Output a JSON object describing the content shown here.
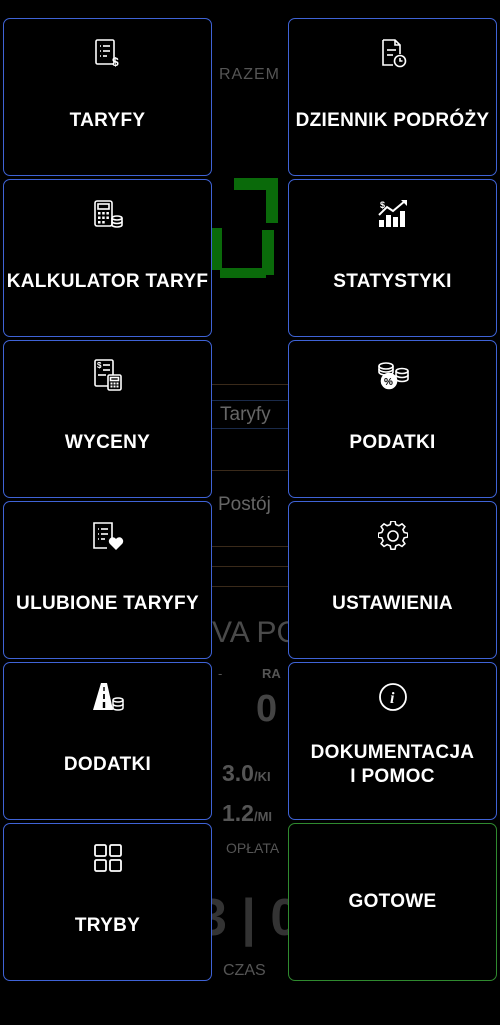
{
  "background": {
    "razem_label": "RAZEM",
    "taryfy_label": "Taryfy",
    "postoj_label": "Postój",
    "nowa_po_label": "VA PC",
    "ra_label": "RA",
    "dash": "-",
    "zero_value": "0",
    "rate1": "3.0",
    "rate1_unit": "/KI",
    "rate2": "1.2",
    "rate2_unit": "/MI",
    "oplata_label": "OPŁATA",
    "big_digits": "3 | 0",
    "czas_label": "CZAS"
  },
  "menu": {
    "tiles": [
      {
        "label": "TARYFY",
        "icon": "fare-list-dollar-icon"
      },
      {
        "label": "DZIENNIK PODRÓŻY",
        "icon": "trip-log-clock-icon"
      },
      {
        "label": "KALKULATOR TARYF",
        "icon": "calculator-coins-icon"
      },
      {
        "label": "STATYSTYKI",
        "icon": "statistics-chart-icon"
      },
      {
        "label": "WYCENY",
        "icon": "quote-calculator-icon"
      },
      {
        "label": "PODATKI",
        "icon": "tax-coins-percent-icon"
      },
      {
        "label": "ULUBIONE TARYFY",
        "icon": "favorite-list-heart-icon"
      },
      {
        "label": "USTAWIENIA",
        "icon": "gear-icon"
      },
      {
        "label": "DODATKI",
        "icon": "road-coins-icon"
      },
      {
        "label": "DOKUMENTACJA",
        "label2": "I POMOC",
        "icon": "info-circle-icon"
      },
      {
        "label": "TRYBY",
        "icon": "grid-modes-icon"
      },
      {
        "label": "GOTOWE"
      }
    ]
  },
  "colors": {
    "tile_border": "#3f63d6",
    "done_border": "#2f8a2f",
    "background": "#000000",
    "text": "#ffffff"
  }
}
